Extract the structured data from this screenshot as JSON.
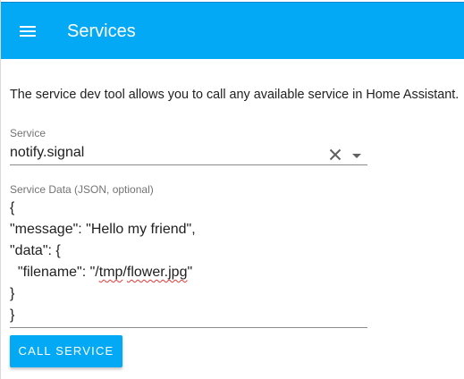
{
  "toolbar": {
    "title": "Services",
    "menu_icon": "hamburger-menu-icon",
    "color": "#03a9f4"
  },
  "description": "The service dev tool allows you to call any available service in Home Assistant.",
  "service_field": {
    "label": "Service",
    "value": "notify.signal",
    "clear_icon": "close-icon",
    "dropdown_icon": "caret-down-icon"
  },
  "service_data_field": {
    "label": "Service Data (JSON, optional)",
    "lines": {
      "l0": "{",
      "l1": "\"message\": \"Hello my friend\",",
      "l2": "\"data\": {",
      "l3_prefix": "  \"filename\": \"/",
      "l3_word1": "tmp",
      "l3_mid": "/",
      "l3_word2": "flower.jpg",
      "l3_suffix": "\"",
      "l4": "}",
      "l5": "}"
    }
  },
  "call_button": {
    "label": "CALL SERVICE"
  }
}
